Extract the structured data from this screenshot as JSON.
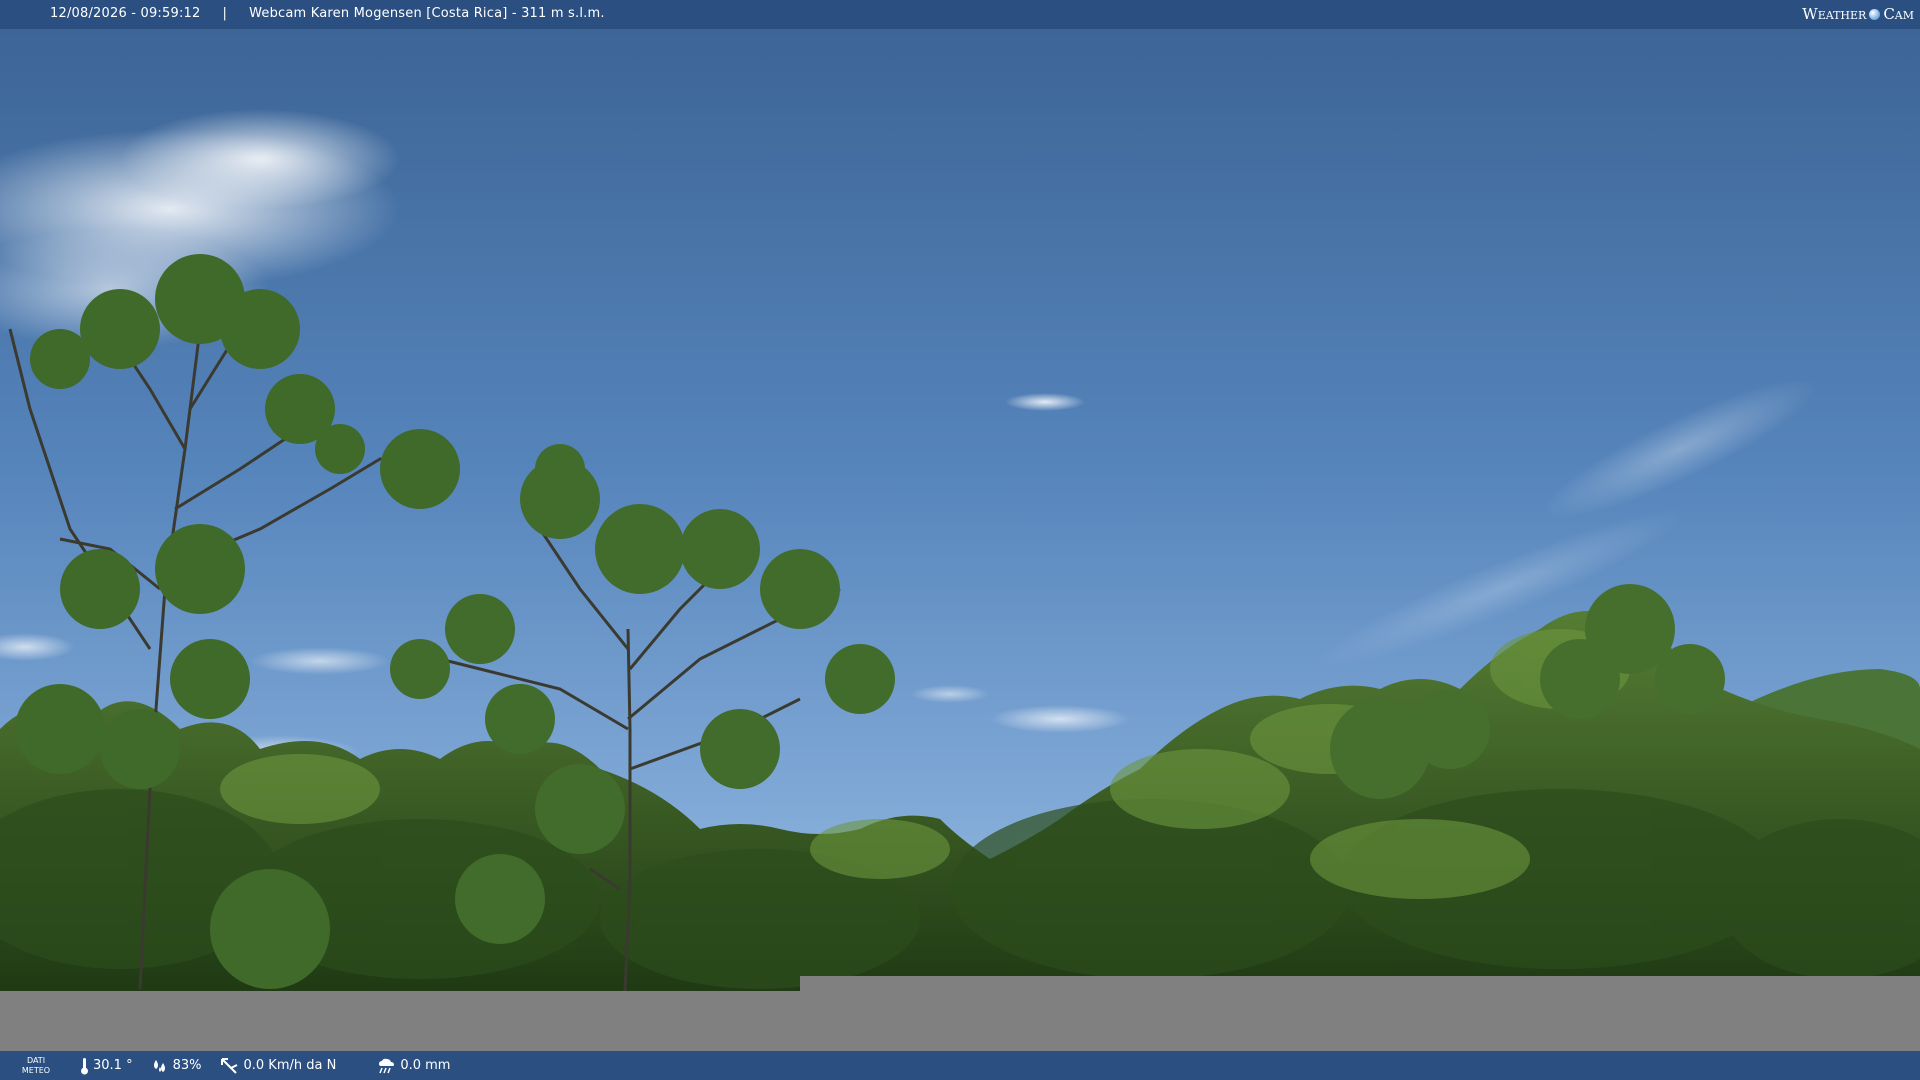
{
  "header": {
    "timestamp": "12/08/2026 - 09:59:12",
    "separator": "|",
    "title": "Webcam Karen Mogensen [Costa Rica] - 311 m s.l.m.",
    "brand_left": "Weather",
    "brand_right": "Cam"
  },
  "weather": {
    "label_line1": "DATI",
    "label_line2": "METEO",
    "temperature": "30.1 °",
    "humidity": "83%",
    "wind": "0.0 Km/h da N",
    "rain": "0.0 mm"
  },
  "colors": {
    "bar": "#2a4f80",
    "sky_top": "#3d6596",
    "sky_horizon": "#9ec0e2",
    "foliage": "#3e6b2a",
    "grey_band": "#808080"
  },
  "icons": {
    "temperature": "thermometer-icon",
    "humidity": "droplets-icon",
    "wind": "wind-vane-icon",
    "rain": "rain-cloud-icon",
    "brand": "weather-cam-logo-icon"
  }
}
